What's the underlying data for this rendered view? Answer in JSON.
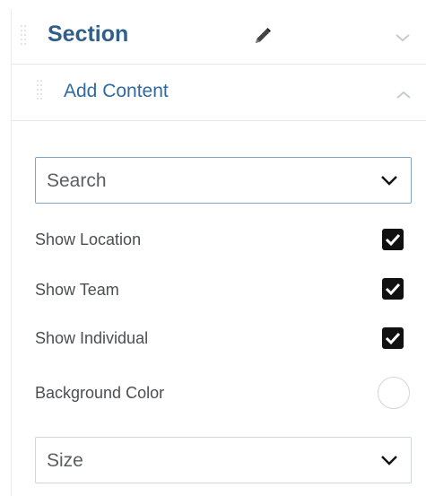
{
  "section": {
    "title": "Section"
  },
  "add_content": {
    "title": "Add Content"
  },
  "search": {
    "value": "Search"
  },
  "options": [
    {
      "label": "Show Location",
      "checked": true
    },
    {
      "label": "Show Team",
      "checked": true
    },
    {
      "label": "Show Individual",
      "checked": true
    }
  ],
  "background_color": {
    "label": "Background Color",
    "value": "#ffffff"
  },
  "size": {
    "value": "Size"
  },
  "icons": {
    "pencil": "pencil-icon",
    "chevron_down": "chevron-down-icon",
    "chevron_up": "chevron-up-icon",
    "checkbox": "checkbox-checked-icon"
  },
  "colors": {
    "section_title": "#2f5f8a",
    "add_content_title": "#2f6aa0",
    "checkbox": "#111111"
  }
}
